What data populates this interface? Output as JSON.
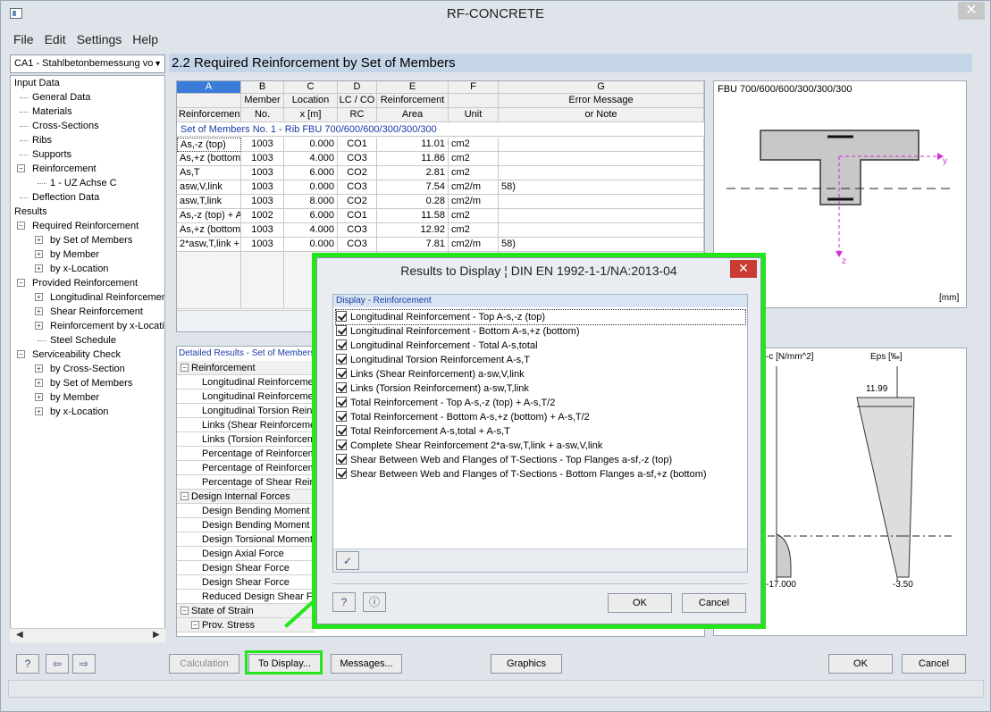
{
  "window": {
    "title": "RF-CONCRETE"
  },
  "menu": [
    "File",
    "Edit",
    "Settings",
    "Help"
  ],
  "nav": {
    "case_combo": "CA1 - Stahlbetonbemessung vo",
    "tree": [
      "Input Data",
      "General Data",
      "Materials",
      "Cross-Sections",
      "Ribs",
      "Supports",
      "Reinforcement",
      "1 - UZ Achse C",
      "Deflection Data",
      "Results",
      "Required Reinforcement",
      "by Set of Members",
      "by Member",
      "by x-Location",
      "Provided Reinforcement",
      "Longitudinal Reinforcement",
      "Shear Reinforcement",
      "Reinforcement by x-Location",
      "Steel Schedule",
      "Serviceability Check",
      "by Cross-Section",
      "by Set of Members",
      "by Member",
      "by x-Location"
    ]
  },
  "section_title": "2.2 Required Reinforcement by Set of Members",
  "grid": {
    "col_letters": [
      "A",
      "B",
      "C",
      "D",
      "E",
      "F",
      "G"
    ],
    "head1": [
      "",
      "Member",
      "Location",
      "LC / CO",
      "Reinforcement",
      "",
      "Error Message"
    ],
    "head2": [
      "Reinforcement",
      "No.",
      "x [m]",
      "RC",
      "Area",
      "Unit",
      "or Note"
    ],
    "group": "Set of Members No. 1  -  Rib FBU 700/600/600/300/300/300",
    "rows": [
      [
        "As,-z (top)",
        "1003",
        "0.000",
        "CO1",
        "11.01",
        "cm2",
        ""
      ],
      [
        "As,+z (bottom)",
        "1003",
        "4.000",
        "CO3",
        "11.86",
        "cm2",
        ""
      ],
      [
        "As,T",
        "1003",
        "6.000",
        "CO2",
        "2.81",
        "cm2",
        ""
      ],
      [
        "asw,V,link",
        "1003",
        "0.000",
        "CO3",
        "7.54",
        "cm2/m",
        "58)"
      ],
      [
        "asw,T,link",
        "1003",
        "8.000",
        "CO2",
        "0.28",
        "cm2/m",
        ""
      ],
      [
        "As,-z (top) + A",
        "1002",
        "6.000",
        "CO1",
        "11.58",
        "cm2",
        ""
      ],
      [
        "As,+z (bottom)",
        "1003",
        "4.000",
        "CO3",
        "12.92",
        "cm2",
        ""
      ],
      [
        "2*asw,T,link +",
        "1003",
        "0.000",
        "CO3",
        "7.81",
        "cm2/m",
        "58)"
      ]
    ]
  },
  "cross_section": {
    "label": "FBU 700/600/600/300/300/300",
    "axis_y": "y",
    "axis_z": "z",
    "unit": "[mm]"
  },
  "stress": {
    "col1": "-c [N/mm^2]",
    "col2": "Eps [‰]",
    "top_val": "11.99",
    "bot_left": "-17.000",
    "bot_right": "-3.50"
  },
  "detail": {
    "header": "Detailed Results  -  Set of Members",
    "rows": [
      {
        "t": "Reinforcement",
        "g": true
      },
      {
        "t": "Longitudinal Reinforcement",
        "g": false
      },
      {
        "t": "Longitudinal Reinforcement",
        "g": false
      },
      {
        "t": "Longitudinal Torsion Reinforc",
        "g": false
      },
      {
        "t": "Links (Shear Reinforcement",
        "g": false
      },
      {
        "t": "Links (Torsion Reinforcement",
        "g": false
      },
      {
        "t": "Percentage of Reinforcement",
        "g": false
      },
      {
        "t": "Percentage of Reinforcement",
        "g": false
      },
      {
        "t": "Percentage of Shear Reinf",
        "g": false
      },
      {
        "t": "Design Internal Forces",
        "g": true
      },
      {
        "t": "Design Bending Moment",
        "g": false
      },
      {
        "t": "Design Bending Moment",
        "g": false
      },
      {
        "t": "Design Torsional Moment",
        "g": false
      },
      {
        "t": "Design Axial Force",
        "g": false
      },
      {
        "t": "Design Shear Force",
        "g": false
      },
      {
        "t": "Design Shear Force",
        "g": false
      },
      {
        "t": "Reduced Design Shear Fo",
        "g": false
      },
      {
        "t": "State of Strain",
        "g": true
      },
      {
        "t": "Prov. Stress",
        "g": true
      }
    ]
  },
  "buttons": {
    "calculation": "Calculation",
    "to_display": "To Display...",
    "messages": "Messages...",
    "graphics": "Graphics",
    "ok": "OK",
    "cancel": "Cancel"
  },
  "dialog": {
    "title": "Results to Display ¦ DIN EN 1992-1-1/NA:2013-04",
    "list_header": "Display - Reinforcement",
    "items": [
      "Longitudinal Reinforcement - Top A-s,-z (top)",
      "Longitudinal Reinforcement - Bottom A-s,+z (bottom)",
      "Longitudinal Reinforcement - Total A-s,total",
      "Longitudinal Torsion Reinforcement A-s,T",
      "Links (Shear Reinforcement) a-sw,V,link",
      "Links (Torsion Reinforcement) a-sw,T,link",
      "Total Reinforcement - Top A-s,-z (top) + A-s,T/2",
      "Total Reinforcement - Bottom A-s,+z (bottom) + A-s,T/2",
      "Total Reinforcement A-s,total + A-s,T",
      "Complete Shear Reinforcement 2*a-sw,T,link + a-sw,V,link",
      "Shear Between Web and Flanges of T-Sections - Top Flanges a-sf,-z (top)",
      "Shear Between Web and Flanges of T-Sections - Bottom Flanges a-sf,+z (bottom)"
    ],
    "ok": "OK",
    "cancel": "Cancel"
  },
  "colors": {
    "highlight": "#22e61a",
    "section_header": "#c5d5e8",
    "close_red": "#c83c34"
  }
}
